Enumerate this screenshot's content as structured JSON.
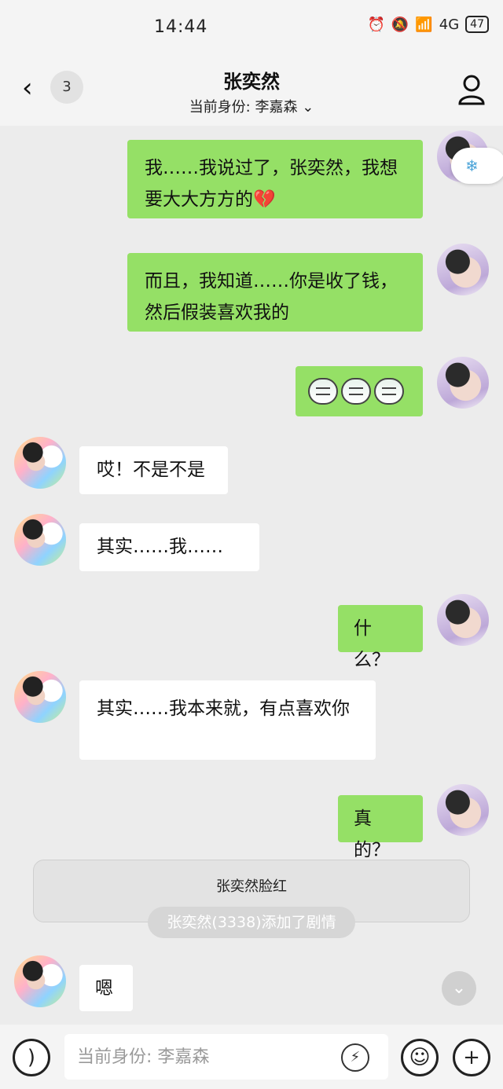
{
  "status_bar": {
    "time": "14:44",
    "icons": [
      "alarm-icon",
      "mute-icon",
      "wifi-icon",
      "signal-4g-icon"
    ],
    "network": "4G",
    "battery": "47"
  },
  "header": {
    "back_count": "3",
    "title": "张奕然",
    "identity": "当前身份: 李嘉森"
  },
  "messages": [
    {
      "side": "me",
      "text": "我……我说过了，张奕然，我想要大大方方的💔"
    },
    {
      "side": "me",
      "text": "而且，我知道……你是收了钱，然后假装喜欢我的"
    },
    {
      "side": "me",
      "type": "stickers",
      "count": 3
    },
    {
      "side": "them",
      "text": "哎！不是不是"
    },
    {
      "side": "them",
      "text": "其实……我……"
    },
    {
      "side": "me",
      "text": "什么？"
    },
    {
      "side": "them",
      "text": "其实……我本来就，有点喜欢你"
    },
    {
      "side": "me",
      "text": "真的？"
    },
    {
      "side": "them",
      "text": "嗯"
    }
  ],
  "event_card": {
    "text": "张奕然脸红",
    "pill": "张奕然(3338)添加了剧情"
  },
  "input_bar": {
    "placeholder": "当前身份: 李嘉森"
  },
  "colors": {
    "my_bubble": "#95e066",
    "their_bubble": "#ffffff",
    "background": "#ececec"
  }
}
